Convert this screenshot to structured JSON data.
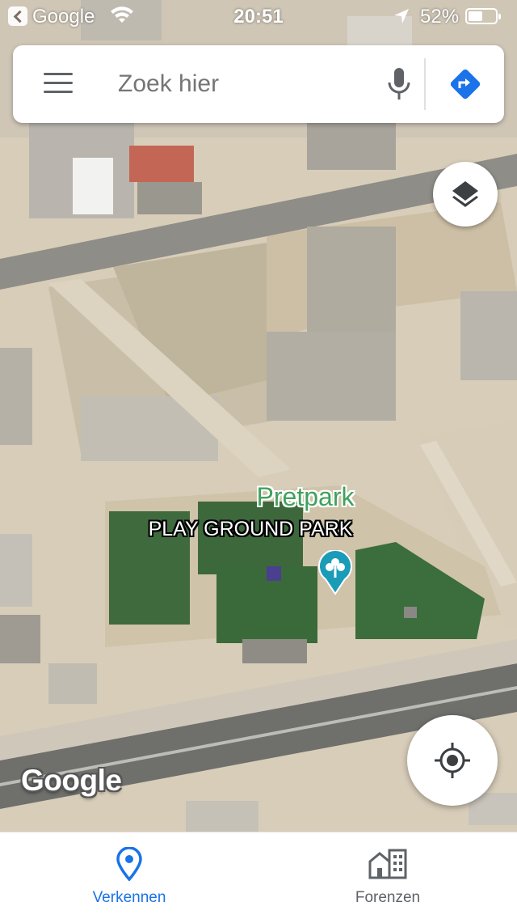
{
  "status_bar": {
    "back_label": "Google",
    "time": "20:51",
    "battery_percent": "52%",
    "battery_level": 0.52,
    "icons": [
      "back-chevron-icon",
      "wifi-icon",
      "location-arrow-icon",
      "battery-icon"
    ]
  },
  "search": {
    "placeholder": "Zoek hier",
    "value": "",
    "menu_icon": "hamburger-menu-icon",
    "mic_icon": "microphone-icon",
    "directions_icon": "directions-icon"
  },
  "map": {
    "poi_name": "Pretpark",
    "place_label": "PLAY GROUND PARK",
    "poi_icon": "amusement-park-tree-icon",
    "logo": "Google",
    "layers_icon": "layers-icon",
    "my_location_icon": "my-location-crosshair-icon",
    "colors": {
      "poi_green": "#41a15d",
      "poi_marker": "#1a9bb8",
      "accent_blue": "#1a73e8"
    }
  },
  "bottom_nav": {
    "tabs": [
      {
        "label": "Verkennen",
        "icon": "location-pin-icon",
        "active": true
      },
      {
        "label": "Forenzen",
        "icon": "buildings-icon",
        "active": false
      }
    ]
  }
}
